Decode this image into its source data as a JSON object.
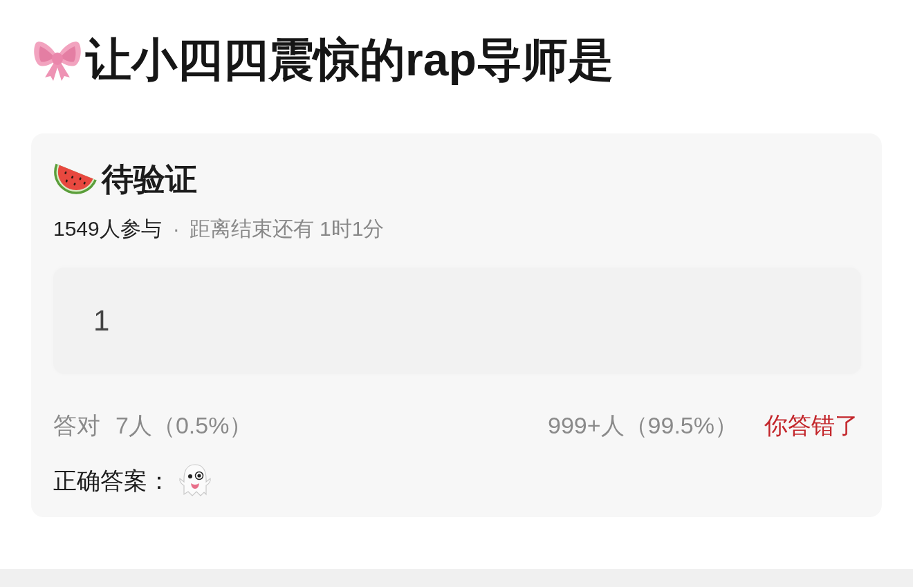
{
  "title": {
    "text": "让小四四震惊的rap导师是"
  },
  "quiz": {
    "status": "待验证",
    "participants": "1549人参与",
    "separator": "·",
    "time_left": "距离结束还有 1时1分",
    "answer": {
      "value": "1"
    },
    "stats": {
      "correct_label": "答对",
      "correct_count": "7人（0.5%）",
      "wrong_count": "999+人（99.5%）",
      "result": {
        "text": "你答错了",
        "correct": false
      }
    },
    "correct_answer_label": "正确答案："
  }
}
